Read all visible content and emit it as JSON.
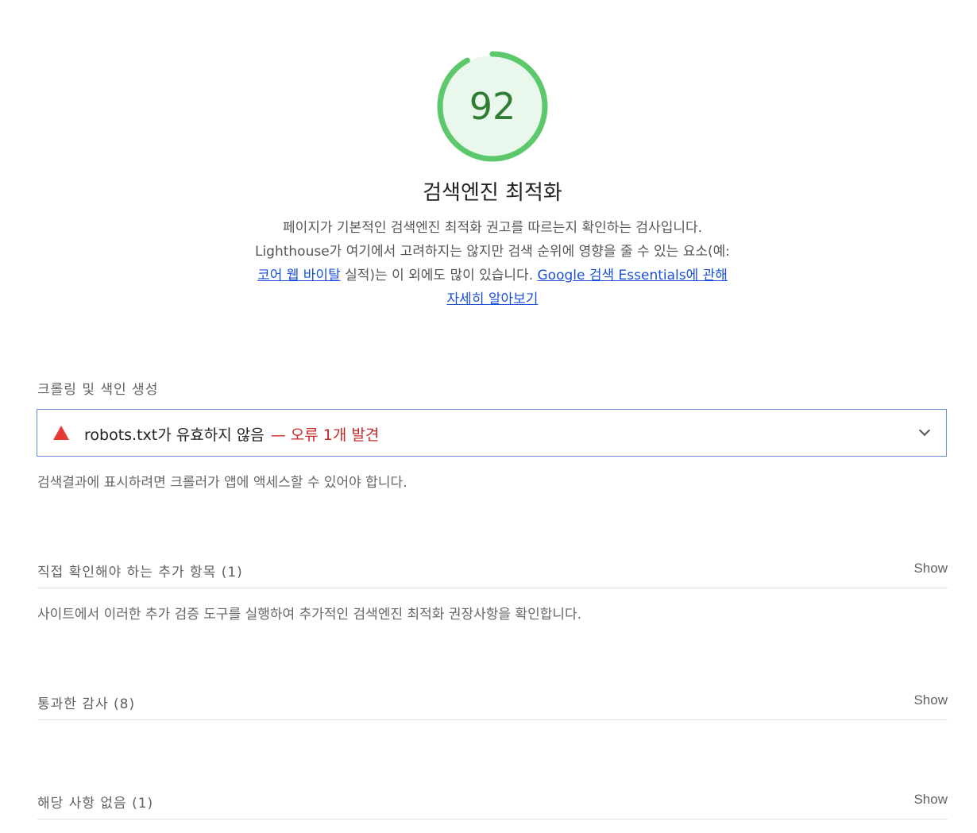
{
  "gauge": {
    "score": "92",
    "score_fraction": 0.92,
    "color": "#5cc86c",
    "fill": "#eaf7ec",
    "text_color": "#2e7d32"
  },
  "category": {
    "title": "검색엔진 최적화",
    "desc_part1": "페이지가 기본적인 검색엔진 최적화 권고를 따르는지 확인하는 검사입니다. Lighthouse가 여기에서 고려하지는 않지만 검색 순위에 영향을 줄 수 있는 요소(예: ",
    "desc_link1": "코어 웹 바이탈",
    "desc_part2": " 실적)는 이 외에도 많이 있습니다. ",
    "desc_link2": "Google 검색 Essentials에 관해 자세히 알아보기"
  },
  "crawl_group": {
    "title": "크롤링 및 색인 생성",
    "audit_title": "robots.txt가 유효하지 않음",
    "audit_error": "— 오류 1개 발견",
    "description": "검색결과에 표시하려면 크롤러가 앱에 액세스할 수 있어야 합니다."
  },
  "manual": {
    "label": "직접 확인해야 하는 추가 항목",
    "count": "(1)",
    "show": "Show",
    "description": "사이트에서 이러한 추가 검증 도구를 실행하여 추가적인 검색엔진 최적화 권장사항을 확인합니다."
  },
  "passed": {
    "label": "통과한 감사",
    "count": "(8)",
    "show": "Show"
  },
  "not_applicable": {
    "label": "해당 사항 없음",
    "count": "(1)",
    "show": "Show"
  },
  "colors": {
    "link": "#1a4fd6",
    "error": "#c62828",
    "warn_icon": "#e53935",
    "audit_border": "#6b8fe0"
  }
}
